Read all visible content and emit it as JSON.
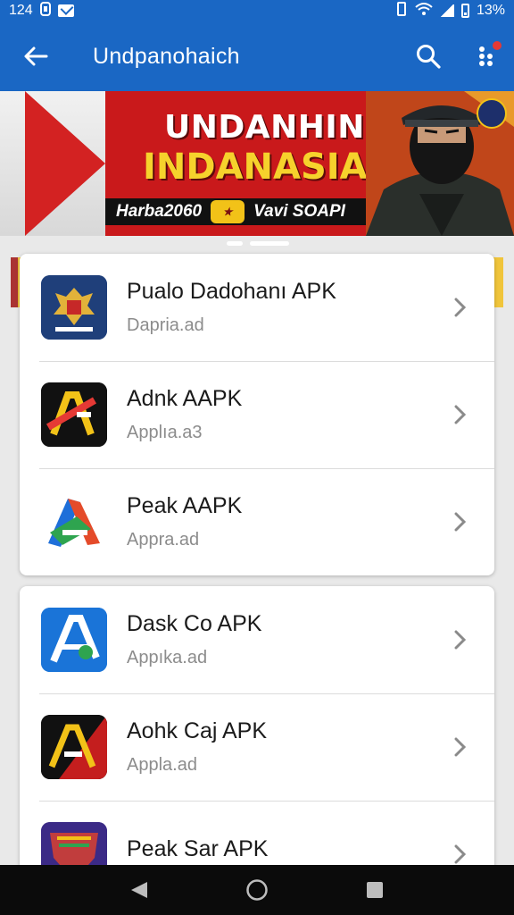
{
  "status_bar": {
    "time": "124",
    "battery": "13%"
  },
  "app_bar": {
    "title": "Undpanohaich",
    "back_icon": "arrow-left-icon",
    "search_icon": "search-icon",
    "more_icon": "more-vert-icon"
  },
  "banner": {
    "line1": "UNDANHIN",
    "line2": "INDANASIA",
    "strip_left": "Harba2060",
    "strip_right": "Vavi SOAPI"
  },
  "lists": [
    {
      "items": [
        {
          "title": "Pualo Dadohanı APK",
          "subtitle": "Dapria.ad",
          "icon": "garuda-icon"
        },
        {
          "title": "Adnk AAPK",
          "subtitle": "Applıa.a3",
          "icon": "a-logo-red-icon"
        },
        {
          "title": "Peak AAPK",
          "subtitle": "Appra.ad",
          "icon": "a-logo-colorful-icon"
        }
      ]
    },
    {
      "items": [
        {
          "title": "Dask Co APK",
          "subtitle": "Appıka.ad",
          "icon": "a-logo-blue-icon"
        },
        {
          "title": "Aohk Caj APK",
          "subtitle": "Appla.ad",
          "icon": "a-logo-red-black-icon"
        },
        {
          "title": "Peak Sar APK",
          "subtitle": "",
          "icon": "shield-logo-icon"
        }
      ]
    }
  ],
  "colors": {
    "app_bar": "#1a67c4",
    "banner_red": "#c9191b",
    "banner_yellow": "#f6d22c",
    "nav_bar": "#0b0b0b"
  },
  "nav": {
    "back": "triangle-back-icon",
    "home": "circle-home-icon",
    "recents": "square-recents-icon"
  }
}
